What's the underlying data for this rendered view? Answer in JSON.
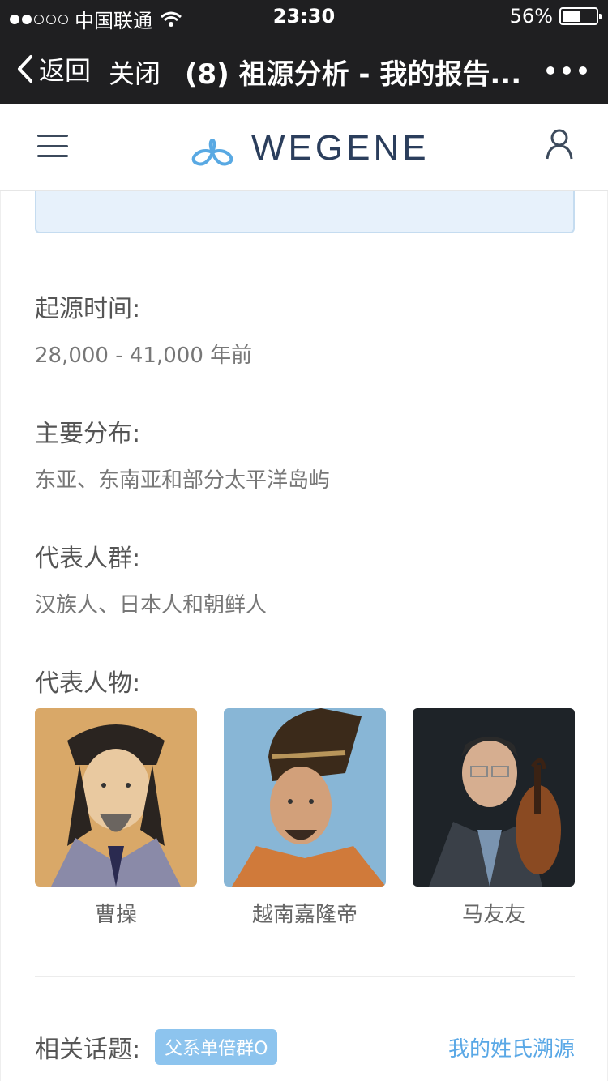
{
  "status_bar": {
    "carrier": "中国联通",
    "time": "23:30",
    "battery_percent": "56%",
    "battery_level": 0.56,
    "signal_bars": 2
  },
  "nav": {
    "back_label": "返回",
    "close_label": "关闭",
    "title": "(8) 祖源分析 - 我的报告..."
  },
  "header": {
    "logo_text": "WEGENE"
  },
  "details": [
    {
      "label": "起源时间:",
      "value": "28,000 - 41,000 年前"
    },
    {
      "label": "主要分布:",
      "value": "东亚、东南亚和部分太平洋岛屿"
    },
    {
      "label": "代表人群:",
      "value": "汉族人、日本人和朝鲜人"
    }
  ],
  "figures": {
    "label": "代表人物:",
    "people": [
      {
        "name": "曹操",
        "image": "portrait-painting"
      },
      {
        "name": "越南嘉隆帝",
        "image": "portrait-painting"
      },
      {
        "name": "马友友",
        "image": "photo-with-cello"
      }
    ]
  },
  "topics": {
    "label": "相关话题:",
    "tag": "父系单倍群O",
    "link": "我的姓氏溯源"
  },
  "colors": {
    "nav_bg": "#1f1f21",
    "accent_link": "#5aa8e6",
    "tag_bg": "#8dc4ee",
    "logo_text": "#2b3e5c"
  }
}
